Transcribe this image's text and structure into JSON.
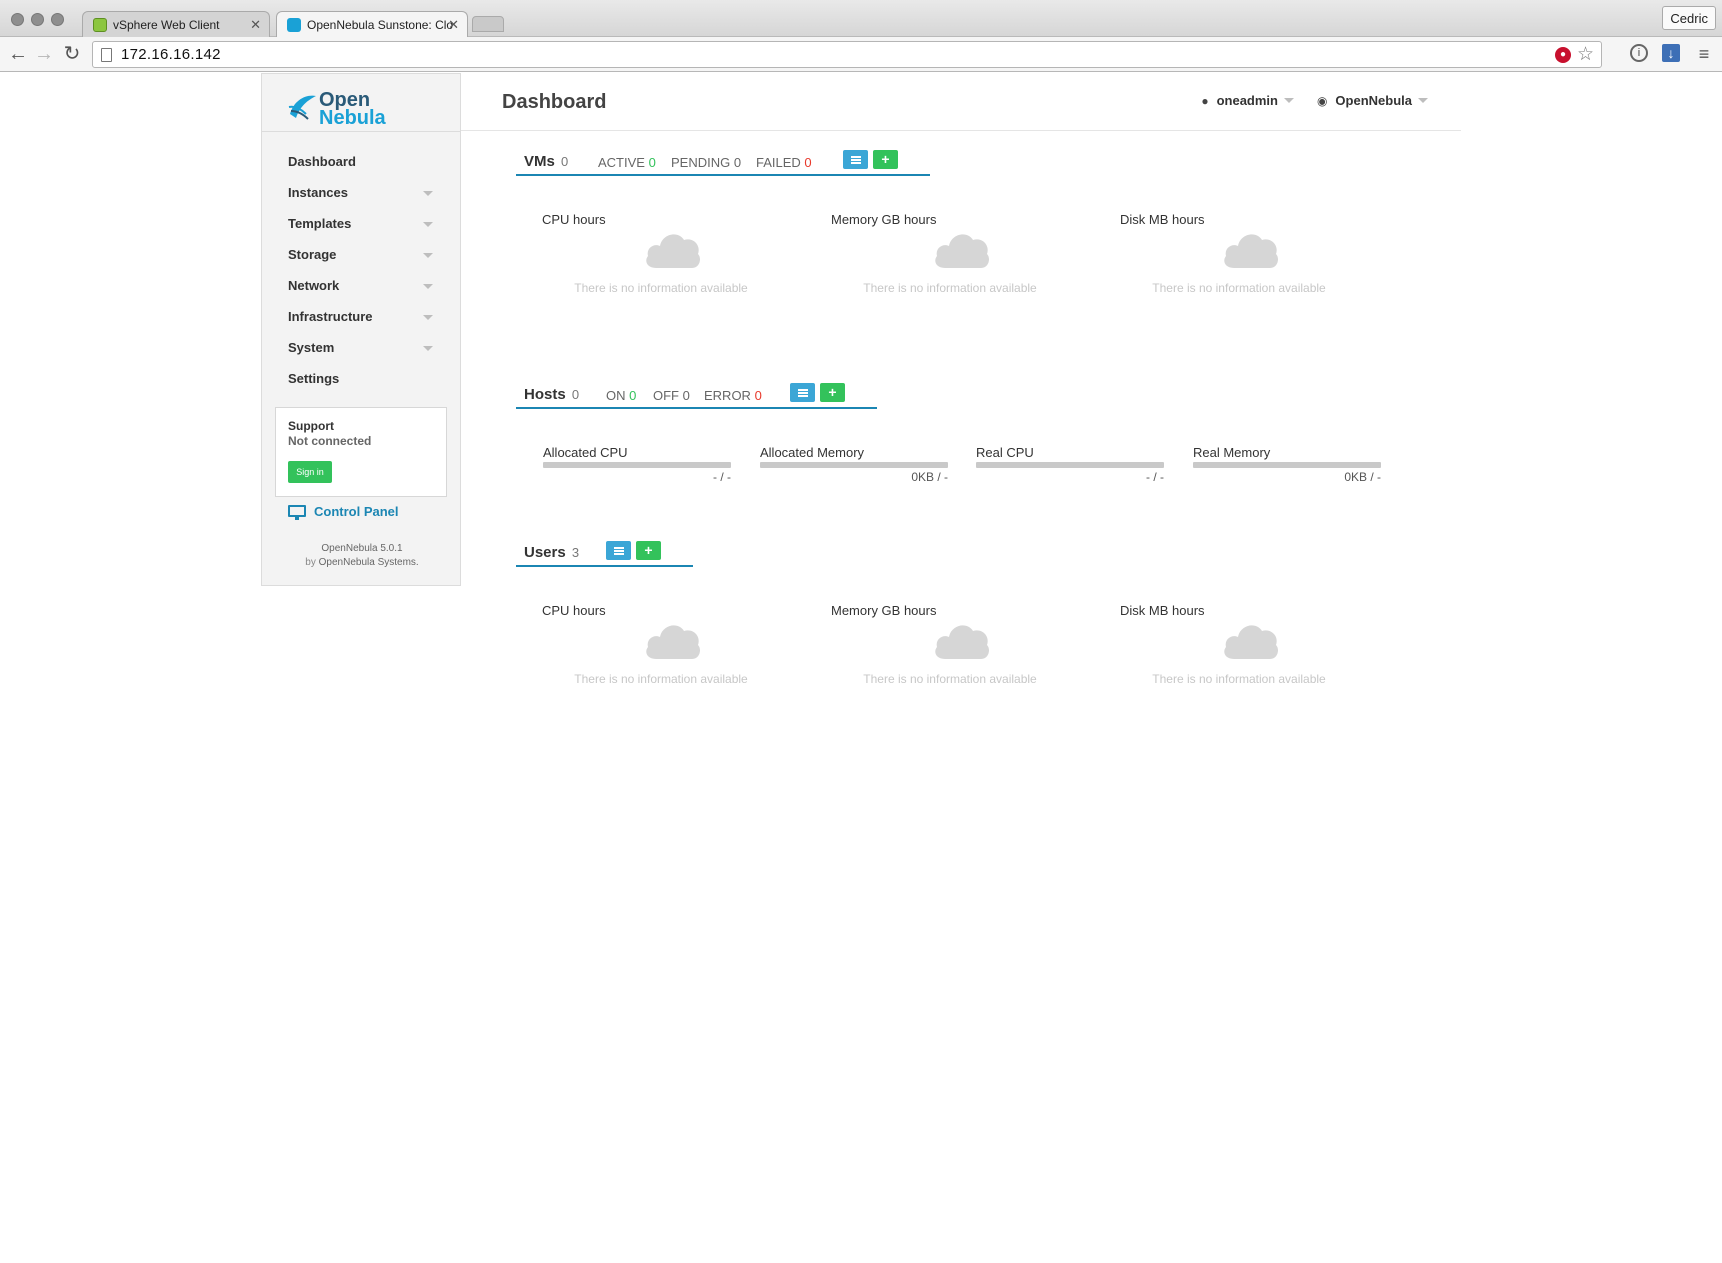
{
  "browser": {
    "tabs": [
      {
        "label": "vSphere Web Client",
        "active": false
      },
      {
        "label": "OpenNebula Sunstone: Clo",
        "active": true
      }
    ],
    "url": "172.16.16.142",
    "profile": "Cedric"
  },
  "app": {
    "logo": {
      "line1": "Open",
      "line2": "Nebula"
    },
    "page_title": "Dashboard",
    "user": "oneadmin",
    "zone": "OpenNebula",
    "colors": {
      "accent": "#1b86b3",
      "green": "#33c25b",
      "red": "#e8392b",
      "list_button": "#3ba6d6"
    }
  },
  "sidebar": {
    "items": [
      {
        "label": "Dashboard",
        "has_submenu": false
      },
      {
        "label": "Instances",
        "has_submenu": true
      },
      {
        "label": "Templates",
        "has_submenu": true
      },
      {
        "label": "Storage",
        "has_submenu": true
      },
      {
        "label": "Network",
        "has_submenu": true
      },
      {
        "label": "Infrastructure",
        "has_submenu": true
      },
      {
        "label": "System",
        "has_submenu": true
      },
      {
        "label": "Settings",
        "has_submenu": false
      }
    ],
    "support": {
      "title": "Support",
      "status": "Not connected",
      "signin_label": "Sign in"
    },
    "control_panel": "Control Panel",
    "version": "OpenNebula 5.0.1",
    "by_prefix": "by",
    "vendor": "OpenNebula Systems."
  },
  "vms": {
    "title": "VMs",
    "count": "0",
    "active_label": "ACTIVE",
    "active": "0",
    "pending_label": "PENDING",
    "pending": "0",
    "failed_label": "FAILED",
    "failed": "0",
    "add_label": "+",
    "widgets": [
      {
        "label": "CPU hours",
        "empty": "There is no information available"
      },
      {
        "label": "Memory GB hours",
        "empty": "There is no information available"
      },
      {
        "label": "Disk MB hours",
        "empty": "There is no information available"
      }
    ]
  },
  "hosts": {
    "title": "Hosts",
    "count": "0",
    "on_label": "ON",
    "on": "0",
    "off_label": "OFF",
    "off": "0",
    "error_label": "ERROR",
    "error": "0",
    "add_label": "+",
    "bars": [
      {
        "label": "Allocated CPU",
        "value": "- / -",
        "fill": 0
      },
      {
        "label": "Allocated Memory",
        "value": "0KB / -",
        "fill": 0
      },
      {
        "label": "Real CPU",
        "value": "- / -",
        "fill": 0
      },
      {
        "label": "Real Memory",
        "value": "0KB / -",
        "fill": 0
      }
    ]
  },
  "users": {
    "title": "Users",
    "count": "3",
    "add_label": "+",
    "widgets": [
      {
        "label": "CPU hours",
        "empty": "There is no information available"
      },
      {
        "label": "Memory GB hours",
        "empty": "There is no information available"
      },
      {
        "label": "Disk MB hours",
        "empty": "There is no information available"
      }
    ]
  }
}
